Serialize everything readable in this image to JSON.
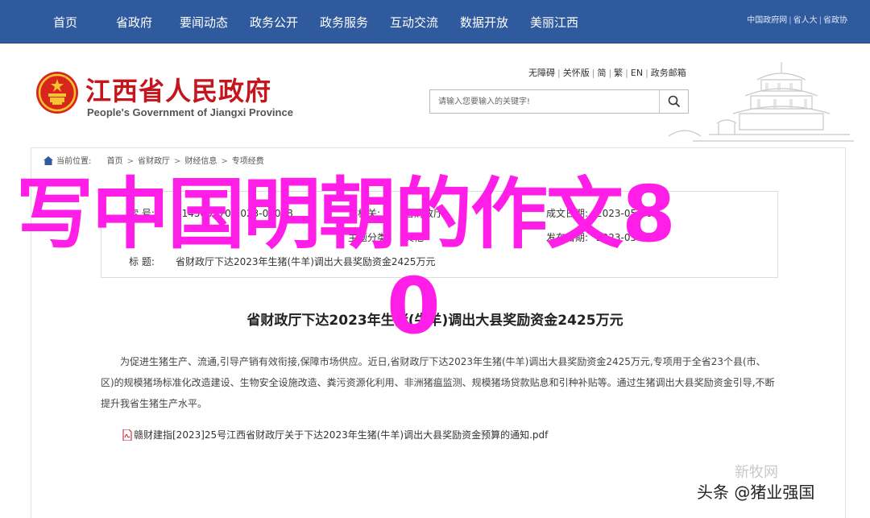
{
  "topnav": {
    "items": [
      "首页",
      "省政府",
      "要闻动态",
      "政务公开",
      "政务服务",
      "互动交流",
      "数据开放",
      "美丽江西"
    ],
    "links": [
      "中国政府网",
      "省人大",
      "省政协"
    ]
  },
  "header": {
    "title": "江西省人民政府",
    "subtitle": "People's Government of Jiangxi Province",
    "util_links": [
      "无障碍",
      "关怀版",
      "简",
      "繁",
      "EN",
      "政务邮箱"
    ],
    "search": {
      "placeholder": "请输入您要输入的关键字!"
    }
  },
  "breadcrumb": {
    "label": "当前位置:",
    "items": [
      "首页",
      "省财政厅",
      "财经信息",
      "专项经费"
    ]
  },
  "meta": {
    "index_label": "索 号:",
    "index_value": "014500970/2023-00028",
    "org_label": "文机关:",
    "org_value": "省财政厅",
    "date_label": "成文日期:",
    "date_value": "2023-05-30",
    "category_label": "主题分类:",
    "category_value": "其他",
    "issued_label": "发布日期:",
    "issued_value": "2023-05-30",
    "title_label": "标 题:",
    "title_value": "省财政厅下达2023年生猪(牛羊)调出大县奖励资金2425万元"
  },
  "article": {
    "title": "省财政厅下达2023年生猪(牛羊)调出大县奖励资金2425万元",
    "body": "为促进生猪生产、流通,引导产销有效衔接,保障市场供应。近日,省财政厅下达2023年生猪(牛羊)调出大县奖励资金2425万元,专项用于全省23个县(市、区)的规模猪场标准化改造建设、生物安全设施改造、粪污资源化利用、非洲猪瘟监测、规模猪场贷款贴息和引种补贴等。通过生猪调出大县奖励资金引导,不断提升我省生猪生产水平。",
    "attachment": "赣财建指[2023]25号江西省财政厅关于下达2023年生猪(牛羊)调出大县奖励资金预算的通知.pdf"
  },
  "overlay": {
    "line1": "写中国明朝的作文8",
    "line2": "0"
  },
  "watermarks": {
    "xinhua": "新牧网",
    "toutiao": "头条 @猪业强国"
  },
  "colors": {
    "nav_bg": "#2f5a9e",
    "title_red": "#c4161c",
    "overlay_magenta": "#ff1ee8"
  }
}
